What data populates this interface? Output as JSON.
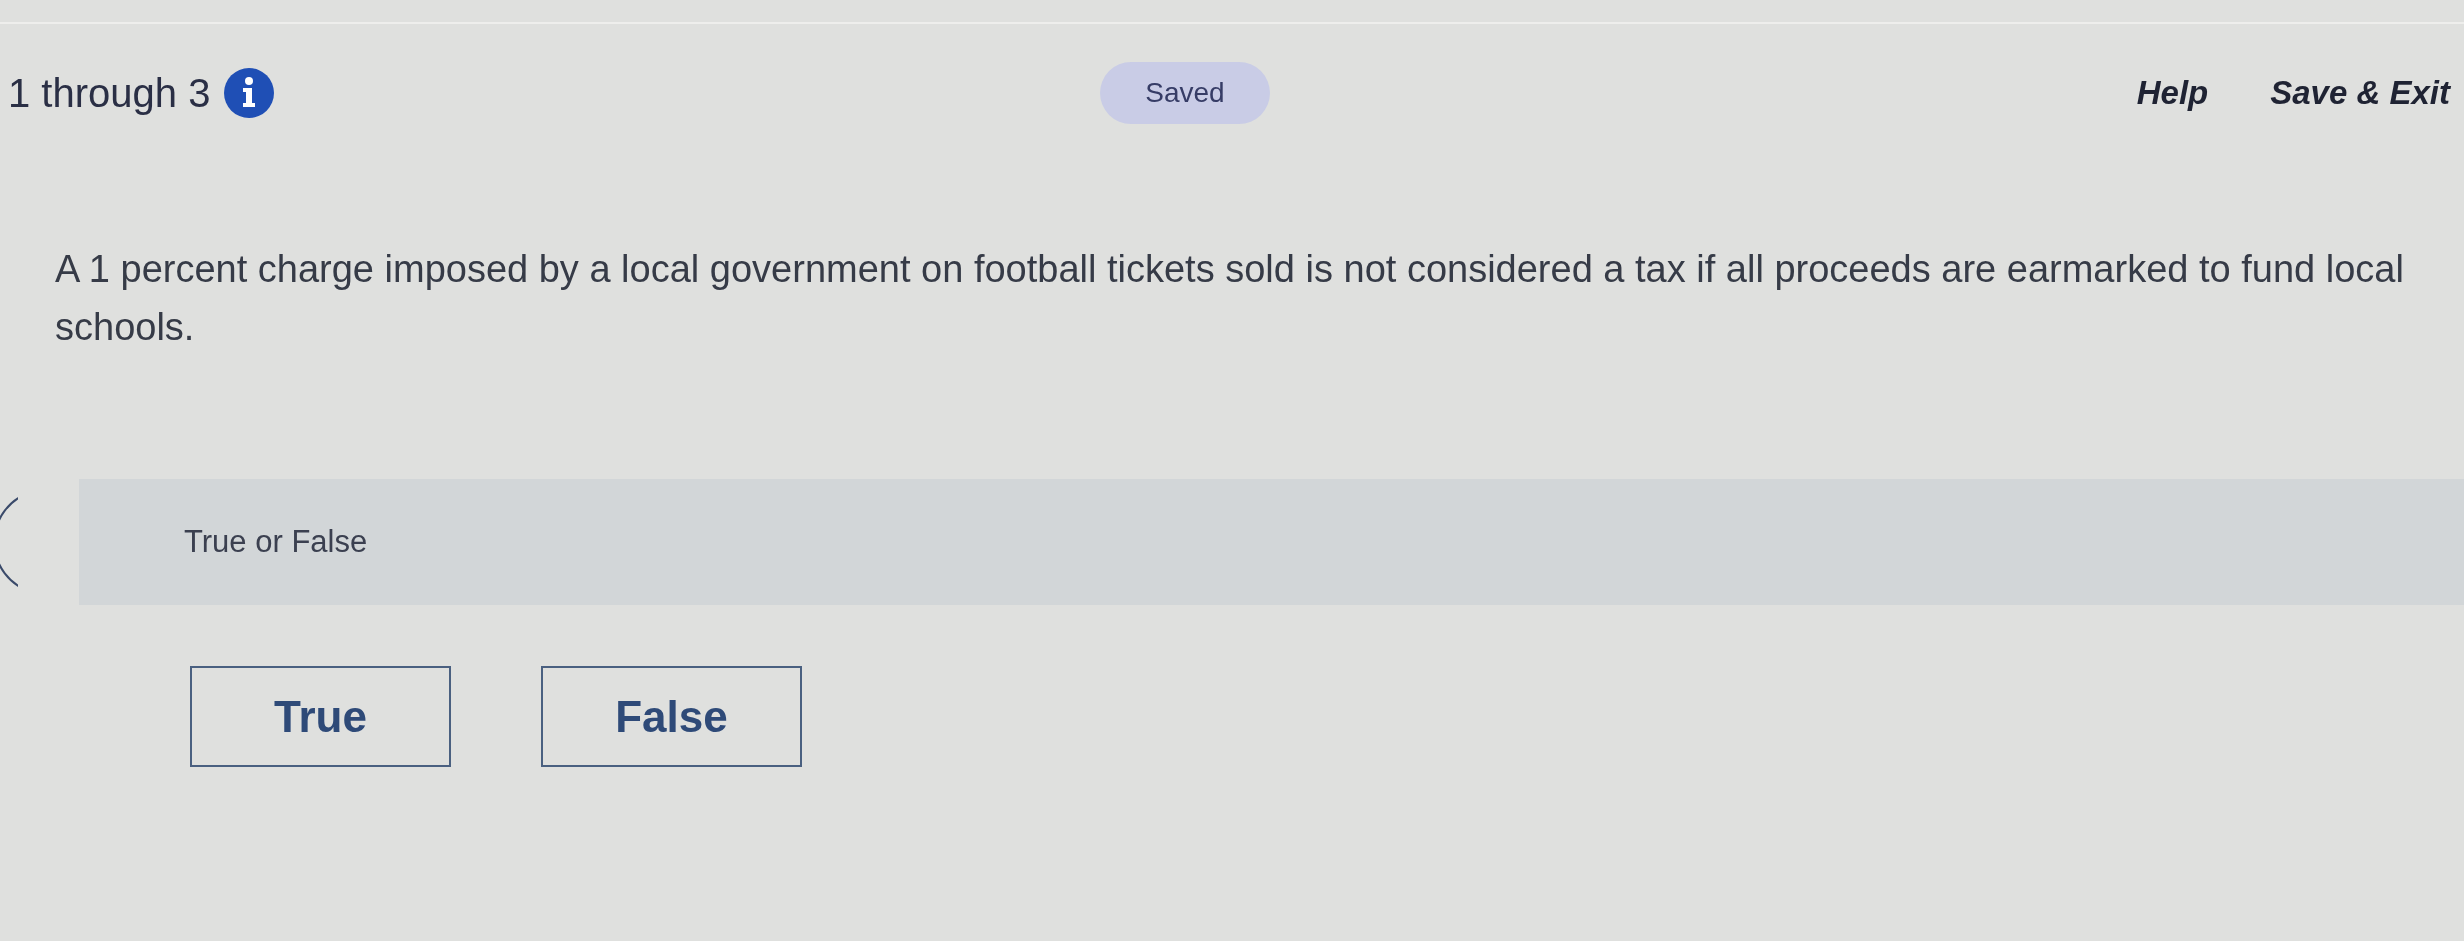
{
  "header": {
    "title": "1 through 3",
    "status": "Saved",
    "links": [
      "Help",
      "Save & Exit"
    ]
  },
  "question": {
    "text": "A 1 percent charge imposed by a local government on football tickets sold is not considered a tax if all proceeds are earmarked to fund local schools.",
    "prompt": "True or False",
    "choices": [
      {
        "label": "True",
        "selected": false
      },
      {
        "label": "False",
        "selected": false
      }
    ]
  }
}
